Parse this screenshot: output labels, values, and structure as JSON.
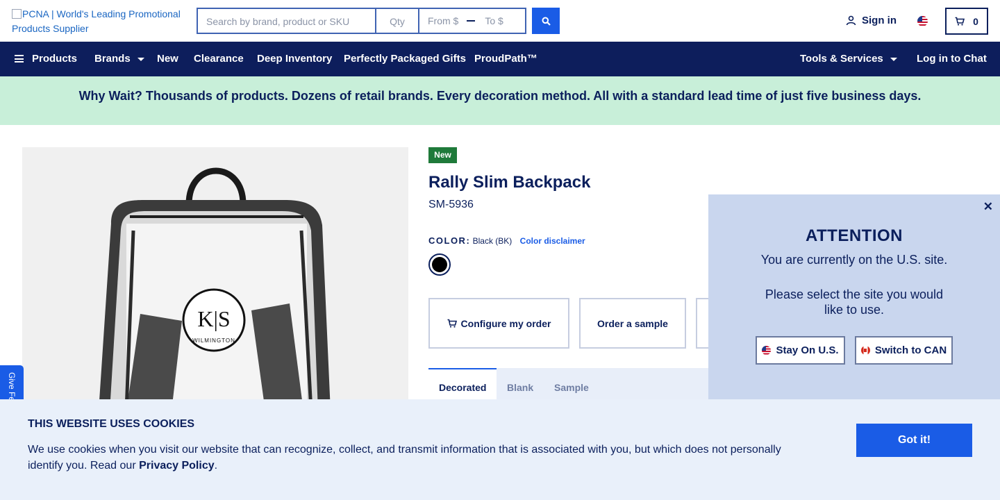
{
  "header": {
    "logo_alt": "PCNA | World's Leading Promotional Products Supplier",
    "search_placeholder": "Search by brand, product or SKU",
    "qty_placeholder": "Qty",
    "price_from_placeholder": "From $",
    "price_to_placeholder": "To $",
    "signin_label": "Sign in",
    "cart_count": "0"
  },
  "nav": {
    "products": "Products",
    "brands": "Brands",
    "new": "New",
    "clearance": "Clearance",
    "deep_inventory": "Deep Inventory",
    "gifts": "Perfectly Packaged Gifts",
    "proudpath": "ProudPath™",
    "tools": "Tools & Services",
    "chat": "Log in to Chat"
  },
  "promo": {
    "text": "Why Wait? Thousands of products. Dozens of retail brands. Every decoration method. All with a standard lead time of just five business days."
  },
  "product": {
    "badge": "New",
    "title": "Rally Slim Backpack",
    "sku": "SM-5936",
    "color_label": "COLOR:",
    "color_value": "Black (BK)",
    "color_disclaimer": "Color disclaimer",
    "logo_letters": "K|S",
    "logo_text": "WILMINGTON",
    "swatch_color": "#000000"
  },
  "actions": {
    "configure": "Configure my order",
    "sample": "Order a sample"
  },
  "tabs": {
    "decorated": "Decorated",
    "blank": "Blank",
    "sample": "Sample"
  },
  "modal": {
    "title": "ATTENTION",
    "message1": "You are currently on the U.S. site.",
    "message2": "Please select the site you would like to use.",
    "stay_label": "Stay On U.S.",
    "switch_label": "Switch to CAN",
    "close": "✕"
  },
  "feedback": {
    "label": "Give Feedback"
  },
  "cookie": {
    "title": "THIS WEBSITE USES COOKIES",
    "text": "We use cookies when you visit our website that can recognize, collect, and transmit information that is associated with you, but which does not personally identify you. Read our ",
    "link": "Privacy Policy",
    "end": ".",
    "button": "Got it!"
  },
  "colors": {
    "nav_bg": "#0d1e5c",
    "accent": "#1a5ce6",
    "promo_bg": "#c8efd9",
    "badge_new": "#1f7a3a",
    "modal_bg": "#c9d6ee"
  }
}
